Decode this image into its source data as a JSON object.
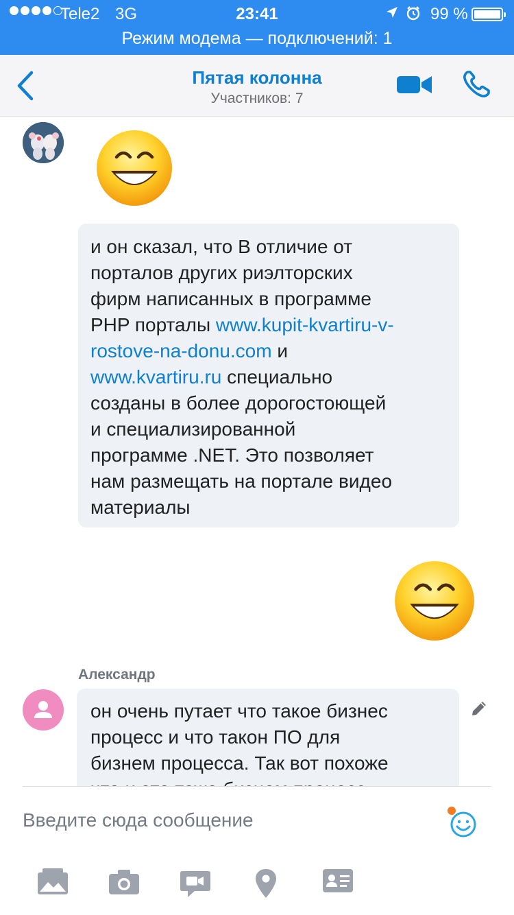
{
  "status_bar": {
    "carrier": "Tele2",
    "network": "3G",
    "time": "23:41",
    "battery_text": "99 %",
    "battery_level": 0.99,
    "hotspot_text": "Режим модема — подключений: 1",
    "background": "#2e8bf0"
  },
  "header": {
    "title": "Пятая колонна",
    "subtitle": "Участников: 7",
    "accent": "#0f7fd0"
  },
  "messages": {
    "first": {
      "lines": [
        {
          "text": "и он сказал, что В отличие от"
        },
        {
          "text": "порталов других риэлторских"
        },
        {
          "text": "фирм написанных в программе"
        },
        {
          "text": "PHP порталы ",
          "link": "www.kupit-kvartiru-v-"
        },
        {
          "link": "rostove-na-donu.com",
          "text": " и"
        },
        {
          "link": "www.kvartiru.ru",
          "text": " специально"
        },
        {
          "text": "созданы в более дорогостоющей"
        },
        {
          "text": "и специализированной"
        },
        {
          "text": "программе .NET. Это позволяет"
        },
        {
          "text": "нам размещать на портале видео"
        },
        {
          "text": "материалы"
        }
      ]
    },
    "second": {
      "sender": "Александр",
      "lines": [
        "он очень путает что такое бизнес",
        "процесс и  что такон ПО для",
        "бизнем процесса. Так вот похоже",
        "что и это тоже бизнем процесс"
      ]
    }
  },
  "composer": {
    "placeholder": "Введите сюда сообщение"
  },
  "icons": {
    "back": "chevron-left-icon",
    "video": "video-camera-icon",
    "call": "phone-icon",
    "edit": "pencil-icon",
    "emoji": "smiley-icon",
    "tools": [
      "image-icon",
      "camera-icon",
      "video-message-icon",
      "location-icon",
      "contact-card-icon"
    ]
  }
}
